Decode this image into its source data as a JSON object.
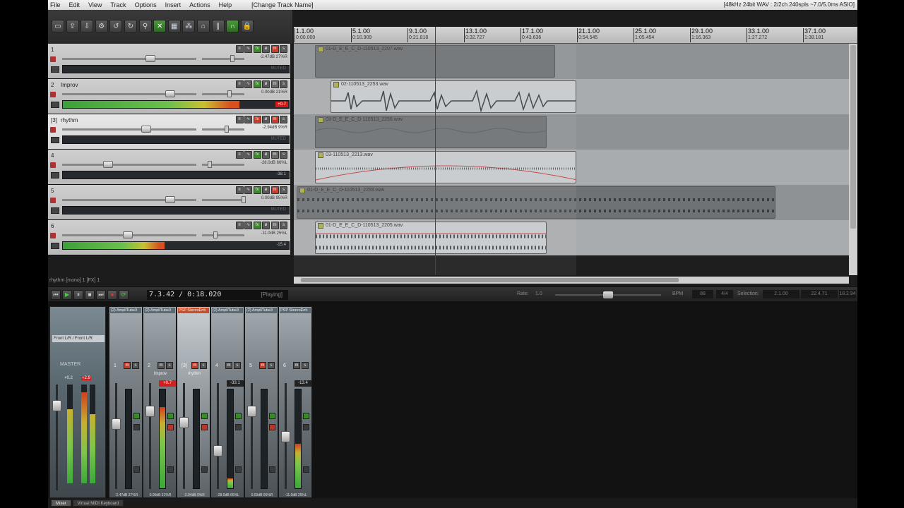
{
  "menu": [
    "File",
    "Edit",
    "View",
    "Track",
    "Options",
    "Insert",
    "Actions",
    "Help"
  ],
  "track_name_tag": "[Change Track Name]",
  "status_info": "[48kHz 24bit WAV : 2/2ch 240spls ~7.0/5.0ms ASIO]",
  "toolbar_icons": [
    "new-project-icon",
    "open-icon",
    "save-icon",
    "settings-icon",
    "undo-icon",
    "redo-icon",
    "metronome-icon",
    "snap-icon",
    "grid-icon",
    "ripple-icon",
    "lock-icon",
    "envelope-icon",
    "lock-toggle-icon"
  ],
  "ruler": [
    {
      "bar": "1.1.00",
      "time": "0:00.000"
    },
    {
      "bar": "5.1.00",
      "time": "0:10.909"
    },
    {
      "bar": "9.1.00",
      "time": "0:21.818"
    },
    {
      "bar": "13.1.00",
      "time": "0:32.727"
    },
    {
      "bar": "17.1.00",
      "time": "0:43.636"
    },
    {
      "bar": "21.1.00",
      "time": "0:54.545"
    },
    {
      "bar": "25.1.00",
      "time": "1:05.454"
    },
    {
      "bar": "29.1.00",
      "time": "1:16.363"
    },
    {
      "bar": "33.1.00",
      "time": "1:27.272"
    },
    {
      "bar": "37.1.00",
      "time": "1:38.181"
    }
  ],
  "tracks": [
    {
      "num": "1",
      "name": "",
      "db": "-2.47dB 27%R",
      "meter": "MUTED",
      "muted": true,
      "level": 0
    },
    {
      "num": "2",
      "name": "Improv",
      "db": "0.00dB 21%R",
      "meter": "+0.7",
      "muted": false,
      "level": 0.78,
      "clip": "+0.7"
    },
    {
      "num": "[3]",
      "name": "rhythm",
      "db": "-2.94dB 9%R",
      "meter": "MUTED",
      "muted": true,
      "level": 0
    },
    {
      "num": "4",
      "name": "",
      "db": "-28.0dB 66%L",
      "meter": "-38.1",
      "muted": false,
      "level": 0
    },
    {
      "num": "5",
      "name": "",
      "db": "0.00dB 95%R",
      "meter": "MUTED",
      "muted": true,
      "level": 0
    },
    {
      "num": "6",
      "name": "",
      "db": "-11.0dB 25%L",
      "meter": "-15.4",
      "muted": false,
      "level": 0.45
    }
  ],
  "items": [
    {
      "label": "01-D_E_E_C_D-110513_2207.wav"
    },
    {
      "label": "02-110513_2253.wav"
    },
    {
      "label": "03-D_E_E_C_D-110513_2256.wav"
    },
    {
      "label": "03-110513_2213.wav"
    },
    {
      "label": "01-D_E_E_C_D-110513_2259.wav"
    },
    {
      "label": "01-D_E_E_C_D-110513_2205.wav"
    }
  ],
  "status_line": "rhythm [mono] 1 [FX] 1",
  "transport": {
    "time": "7.3.42 / 0:18.020",
    "state": "[Playing]",
    "rate_label": "Rate:",
    "rate_value": "1.0",
    "bpm_label": "BPM",
    "bpm": "88",
    "timesig": "4/4",
    "sel_label": "Selection:",
    "sel_start": "2.1.00",
    "sel_end": "22.4.71",
    "sel_len": "18.2.94"
  },
  "master": {
    "io": "Front L/R / Front L/R",
    "label": "MASTER",
    "peak_l": "+0.2",
    "peak_r": "+2.9"
  },
  "mixer_strips": [
    {
      "num": "1",
      "name": "",
      "fx": "(2) AmpliTube3",
      "mute": true,
      "peak": "-",
      "vol": "-2.47dB 27%R",
      "level": 0,
      "fader": 0.38
    },
    {
      "num": "2",
      "name": "Improv",
      "fx": "(2) AmpliTube3",
      "mute": false,
      "peak": "+0.7",
      "clip": true,
      "vol": "0.00dB 21%R",
      "level": 0.82,
      "fader": 0.22
    },
    {
      "num": "[3]",
      "name": "rhythm",
      "fx": "PSP StereoEnh",
      "mute": true,
      "peak": "-",
      "vol": "-2.94dB 9%R",
      "level": 0,
      "fader": 0.36,
      "selected": true
    },
    {
      "num": "4",
      "name": "",
      "fx": "(2) AmpliTube3",
      "mute": false,
      "peak": "-33.1",
      "vol": "-28.0dB 66%L",
      "level": 0.1,
      "fader": 0.63
    },
    {
      "num": "5",
      "name": "",
      "fx": "(2) AmpliTube3",
      "mute": true,
      "peak": "-",
      "vol": "0.00dB 95%R",
      "level": 0,
      "fader": 0.22
    },
    {
      "num": "6",
      "name": "",
      "fx": "PSP StereoEnh",
      "mute": false,
      "peak": "-13.4",
      "vol": "-11.0dB 25%L",
      "level": 0.45,
      "fader": 0.5
    }
  ],
  "bottom_tabs": [
    "Mixer",
    "Virtual MIDI Keyboard"
  ]
}
